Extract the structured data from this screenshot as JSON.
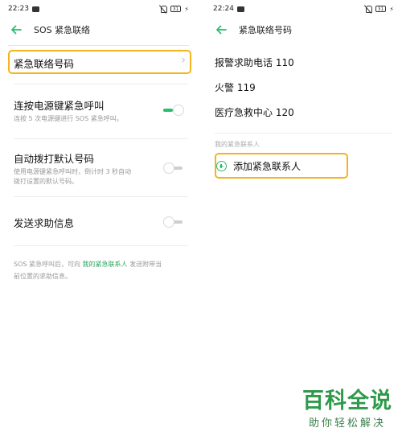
{
  "colors": {
    "accent": "#2bbd6e",
    "highlight": "#f2b51e",
    "link": "#2aa35b",
    "watermark": "#2e9a4a"
  },
  "left": {
    "status": {
      "time": "22:23",
      "battery": "31"
    },
    "title": "SOS 紧急联络",
    "items": {
      "emergency_contacts": "紧急联络号码",
      "power_key": {
        "title": "连按电源键紧急呼叫",
        "subtitle": "连按 5 次电源键进行 SOS 紧急呼叫。",
        "enabled": true
      },
      "auto_dial": {
        "title": "自动拨打默认号码",
        "subtitle_line1": "使用电源键紧急呼叫时，倒计时 3 秒自动",
        "subtitle_line2": "拨打设置的默认号码。",
        "enabled": false
      },
      "send_help": {
        "title": "发送求助信息",
        "enabled": false
      }
    },
    "footnote": {
      "part1": "SOS 紧急呼叫后，可向 ",
      "link": "我的紧急联系人",
      "part2": " 发送附带当",
      "part3": "前位置的求助信息。"
    }
  },
  "right": {
    "status": {
      "time": "22:24",
      "battery": "31"
    },
    "title": "紧急联络号码",
    "numbers": [
      "报警求助电话 110",
      "火警 119",
      "医疗急救中心 120"
    ],
    "section_label": "我的紧急联系人",
    "add_contact": "添加紧急联系人"
  },
  "watermark": {
    "main": "百科全说",
    "sub": "助你轻松解决"
  },
  "icons": {
    "back": "arrow-left-icon",
    "chevron": "chevron-right-icon",
    "add": "plus-circle-icon"
  }
}
